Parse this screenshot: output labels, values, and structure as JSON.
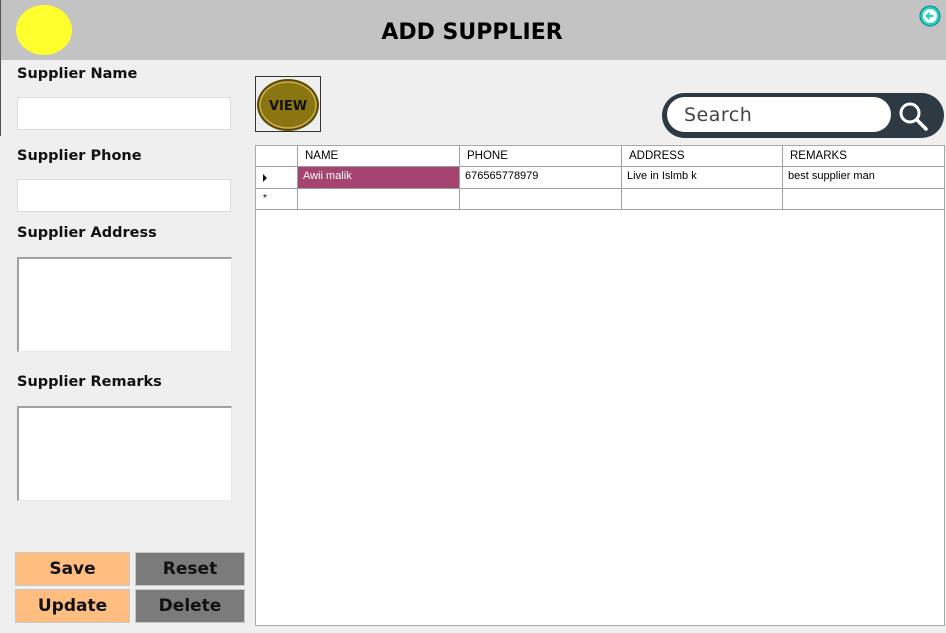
{
  "header": {
    "title": "ADD SUPPLIER"
  },
  "form": {
    "name_label": "Supplier Name",
    "name_value": "",
    "phone_label": "Supplier Phone",
    "phone_value": "",
    "address_label": "Supplier Address",
    "address_value": "",
    "remarks_label": "Supplier Remarks",
    "remarks_value": ""
  },
  "buttons": {
    "save": "Save",
    "reset": "Reset",
    "update": "Update",
    "delete": "Delete"
  },
  "view_button": {
    "label": "VIEW"
  },
  "search": {
    "placeholder": "Search"
  },
  "grid": {
    "columns": [
      "NAME",
      "PHONE",
      "ADDRESS",
      "REMARKS"
    ],
    "rows": [
      {
        "name": "Awii malik",
        "phone": "676565778979",
        "address": "Live in Islmb k",
        "remarks": "best supplier man"
      }
    ],
    "new_row_marker": "*"
  },
  "colors": {
    "header_bg": "#c3c3c3",
    "logo": "#ffff2e",
    "primary_button": "#ffbd80",
    "secondary_button": "#7b7b7b",
    "selected_cell": "#a54371",
    "search_frame": "#2d3a44"
  }
}
